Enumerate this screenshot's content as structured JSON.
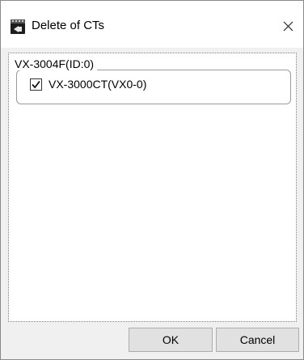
{
  "window": {
    "title": "Delete of CTs",
    "app_icon": "app-icon",
    "close_icon": "close-icon"
  },
  "group": {
    "label": "VX-3004F(ID:0)",
    "items": [
      {
        "label": "VX-3000CT(VX0-0)",
        "checked": true
      }
    ]
  },
  "buttons": {
    "ok": "OK",
    "cancel": "Cancel"
  }
}
